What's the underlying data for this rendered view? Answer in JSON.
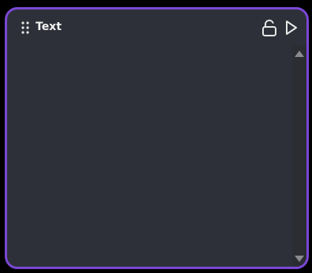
{
  "panel": {
    "title": "Text",
    "icons": {
      "drag": "drag-handle-icon",
      "lock": "unlock-icon",
      "run": "play-icon",
      "scroll_up": "arrow-up-icon",
      "scroll_down": "arrow-down-icon"
    }
  },
  "colors": {
    "background": "#000000",
    "panel_bg": "#2d3038",
    "border_accent": "#7a48d6",
    "text": "#f2f2f2",
    "scrollbar_bg": "#2b2d33",
    "scroll_arrow": "#8a8b8f"
  }
}
